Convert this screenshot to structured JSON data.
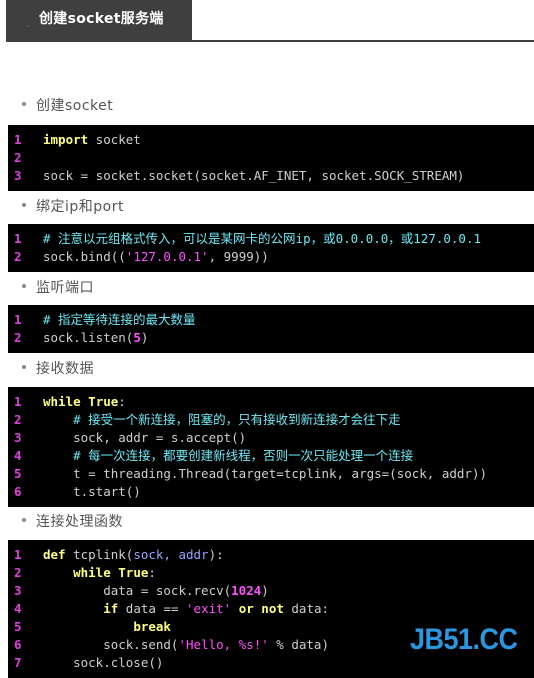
{
  "header": {
    "title": "创建socket服务端"
  },
  "sections": [
    {
      "bullet": "创建socket",
      "code": [
        [
          {
            "t": "import",
            "c": "kw"
          },
          {
            "t": " socket"
          }
        ],
        [
          {
            "t": ""
          }
        ],
        [
          {
            "t": "sock = socket.socket(socket.AF_INET, socket.SOCK_STREAM)"
          }
        ]
      ]
    },
    {
      "bullet": "绑定ip和port",
      "code": [
        [
          {
            "t": "# 注意以元组格式传入，可以是某网卡的公网ip，或0.0.0.0，或127.0.0.1",
            "c": "cm"
          }
        ],
        [
          {
            "t": "sock.bind(("
          },
          {
            "t": "'127.0.0.1'",
            "c": "str"
          },
          {
            "t": ", 9999))"
          }
        ]
      ]
    },
    {
      "bullet": "监听端口",
      "code": [
        [
          {
            "t": "# 指定等待连接的最大数量",
            "c": "cm"
          }
        ],
        [
          {
            "t": "sock.listen("
          },
          {
            "t": "5",
            "c": "num"
          },
          {
            "t": ")"
          }
        ]
      ]
    },
    {
      "bullet": "接收数据",
      "code": [
        [
          {
            "t": "while",
            "c": "kw"
          },
          {
            "t": " "
          },
          {
            "t": "True",
            "c": "kw"
          },
          {
            "t": ":"
          }
        ],
        [
          {
            "t": "    "
          },
          {
            "t": "# 接受一个新连接，阻塞的，只有接收到新连接才会往下走",
            "c": "cm"
          }
        ],
        [
          {
            "t": "    sock, addr = s.accept()"
          }
        ],
        [
          {
            "t": "    "
          },
          {
            "t": "# 每一次连接，都要创建新线程，否则一次只能处理一个连接",
            "c": "cm"
          }
        ],
        [
          {
            "t": "    t = threading.Thread(target=tcplink, args=(sock, addr))"
          }
        ],
        [
          {
            "t": "    t.start()"
          }
        ]
      ]
    },
    {
      "bullet": "连接处理函数",
      "code": [
        [
          {
            "t": "def",
            "c": "kw"
          },
          {
            "t": " tcplink("
          },
          {
            "t": "sock, addr",
            "c": "arg"
          },
          {
            "t": "):"
          }
        ],
        [
          {
            "t": "    "
          },
          {
            "t": "while",
            "c": "kw"
          },
          {
            "t": " "
          },
          {
            "t": "True",
            "c": "kw"
          },
          {
            "t": ":"
          }
        ],
        [
          {
            "t": "        data = sock.recv("
          },
          {
            "t": "1024",
            "c": "num"
          },
          {
            "t": ")"
          }
        ],
        [
          {
            "t": "        "
          },
          {
            "t": "if",
            "c": "kw"
          },
          {
            "t": " data == "
          },
          {
            "t": "'exit'",
            "c": "str"
          },
          {
            "t": " "
          },
          {
            "t": "or",
            "c": "kw"
          },
          {
            "t": " "
          },
          {
            "t": "not",
            "c": "kw"
          },
          {
            "t": " data:"
          }
        ],
        [
          {
            "t": "            "
          },
          {
            "t": "break",
            "c": "kw"
          }
        ],
        [
          {
            "t": "        sock.send("
          },
          {
            "t": "'Hello, %s!'",
            "c": "str"
          },
          {
            "t": " % data)"
          }
        ],
        [
          {
            "t": "    sock.close()"
          }
        ]
      ]
    }
  ],
  "watermark": "JB51.CC"
}
